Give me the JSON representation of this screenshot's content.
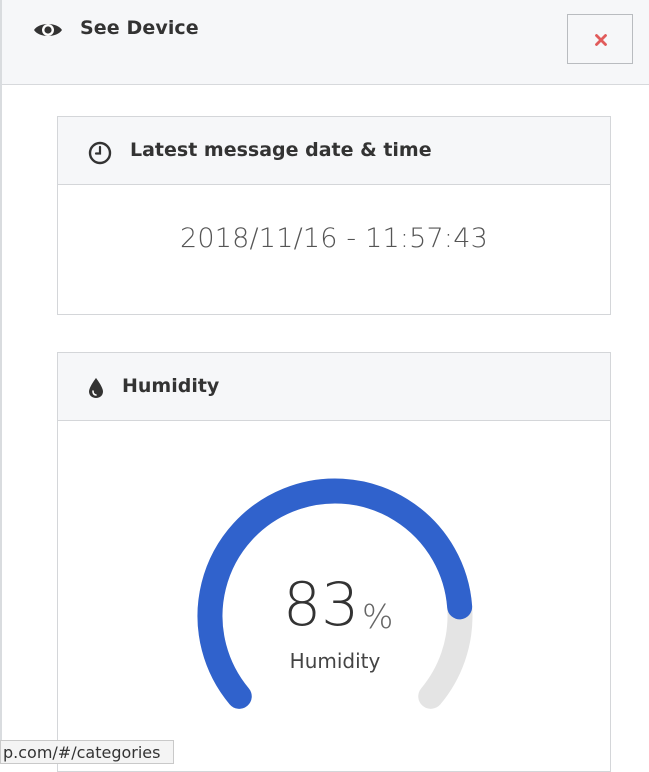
{
  "header": {
    "title": "See Device",
    "icon": "eye-icon",
    "close_icon": "close-icon",
    "close_color": "#e15b5b"
  },
  "message_card": {
    "title": "Latest message date & time",
    "icon": "clock-icon",
    "value": "2018/11/16 - 11:57:43"
  },
  "humidity_card": {
    "title": "Humidity",
    "icon": "water-drop-icon",
    "gauge": {
      "value": "83",
      "unit": "%",
      "label": "Humidity",
      "fraction": 0.83,
      "fill_color": "#3062cc",
      "track_color": "#e4e4e4"
    }
  },
  "status_bar": {
    "url_text": "p.com/#/categories"
  }
}
